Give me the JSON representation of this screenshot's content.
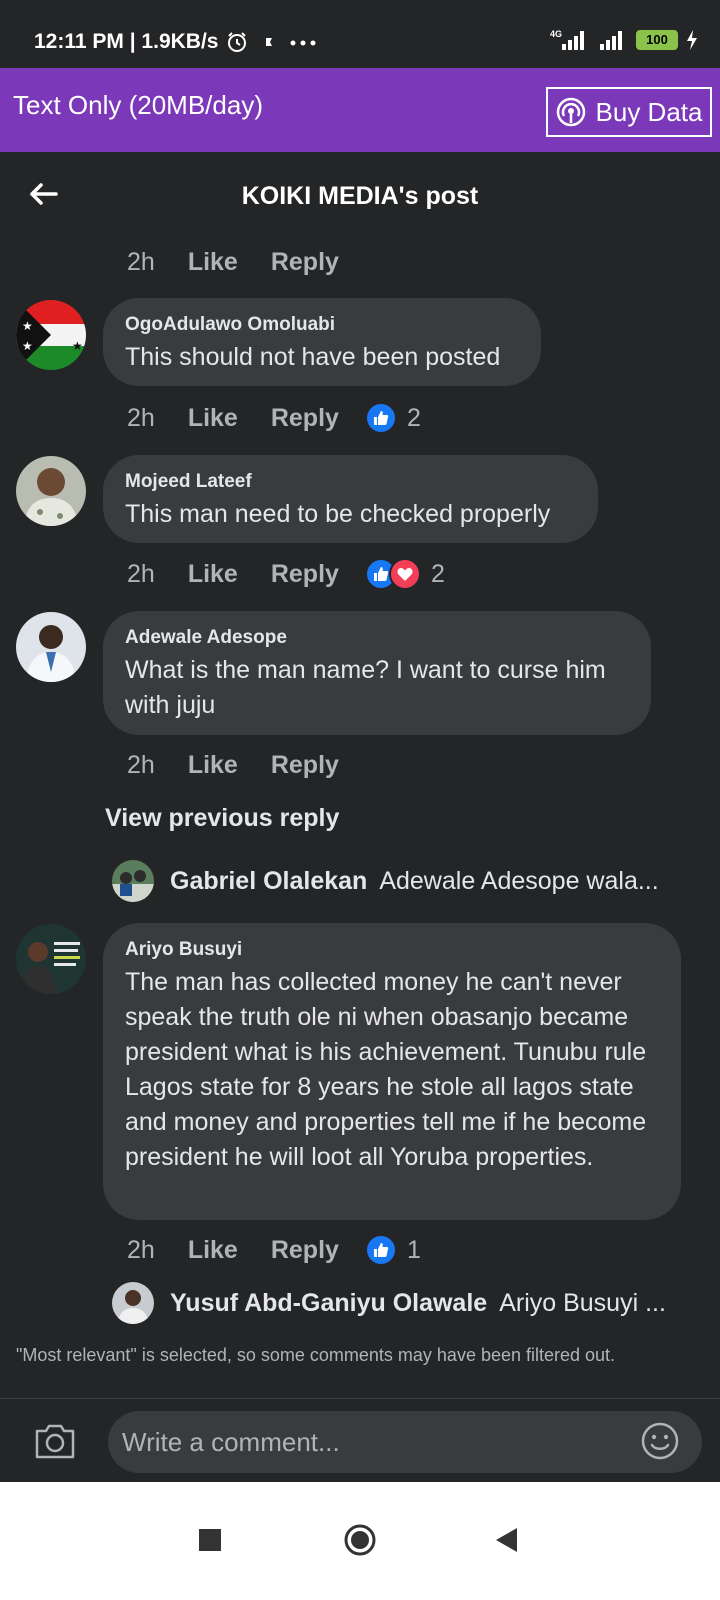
{
  "status": {
    "time": "12:11 PM | 1.9KB/s",
    "battery": "100",
    "network": "4G"
  },
  "databar": {
    "text": "Text Only (20MB/day)",
    "buy_label": "Buy Data"
  },
  "header": {
    "title": "KOIKI MEDIA's post"
  },
  "top_actions": {
    "time": "2h",
    "like": "Like",
    "reply": "Reply"
  },
  "comments": [
    {
      "author": "OgoAdulawo Omoluabi",
      "text": "This should not have been posted",
      "time": "2h",
      "like": "Like",
      "reply": "Reply",
      "reactions": [
        "like"
      ],
      "reaction_count": "2"
    },
    {
      "author": "Mojeed Lateef",
      "text": "This man need to be checked properly",
      "time": "2h",
      "like": "Like",
      "reply": "Reply",
      "reactions": [
        "like",
        "love"
      ],
      "reaction_count": "2"
    },
    {
      "author": "Adewale Adesope",
      "text": "What is the man name? I want to curse him with juju",
      "time": "2h",
      "like": "Like",
      "reply": "Reply"
    },
    {
      "author": "Ariyo Busuyi",
      "text": "The man has collected money he can't never speak the truth ole ni  when obasanjo became president what is his achievement. Tunubu rule Lagos state for 8 years he stole all lagos state and money and properties tell me if he become president he will loot all Yoruba properties.",
      "time": "2h",
      "like": "Like",
      "reply": "Reply",
      "reactions": [
        "like"
      ],
      "reaction_count": "1"
    }
  ],
  "view_previous": "View previous reply",
  "replies": [
    {
      "name": "Gabriel Olalekan",
      "text": "Adewale Adesope wala..."
    },
    {
      "name": "Yusuf Abd-Ganiyu Olawale",
      "text": "Ariyo Busuyi ..."
    }
  ],
  "filter_note": "\"Most relevant\" is selected, so some comments may have been filtered out.",
  "composer": {
    "placeholder": "Write a comment..."
  },
  "colors": {
    "accent_purple": "#7b38b8",
    "background": "#242526",
    "bubble": "#3a3b3c",
    "like_blue": "#1877f2",
    "love_red": "#f33e58"
  }
}
